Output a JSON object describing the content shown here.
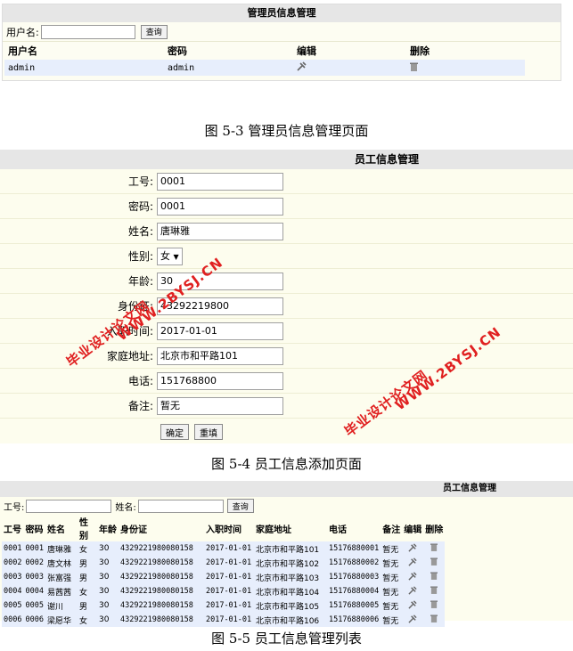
{
  "admin": {
    "title": "管理员信息管理",
    "search_label": "用户名:",
    "search_value": "",
    "search_button": "查询",
    "columns": [
      "用户名",
      "密码",
      "编辑",
      "删除"
    ],
    "rows": [
      {
        "username": "admin",
        "password": "admin"
      }
    ]
  },
  "caption1": "图 5-3 管理员信息管理页面",
  "employee_form": {
    "title": "员工信息管理",
    "fields": [
      {
        "label": "工号:",
        "value": "0001"
      },
      {
        "label": "密码:",
        "value": "0001"
      },
      {
        "label": "姓名:",
        "value": "唐琳雅"
      },
      {
        "label": "性别:",
        "value": "女"
      },
      {
        "label": "年龄:",
        "value": "30"
      },
      {
        "label": "身份证:",
        "value": "43292219800"
      },
      {
        "label": "入职时间:",
        "value": "2017-01-01"
      },
      {
        "label": "家庭地址:",
        "value": "北京市和平路101"
      },
      {
        "label": "电话:",
        "value": "151768800"
      },
      {
        "label": "备注:",
        "value": "暂无"
      }
    ],
    "confirm_button": "确定",
    "reset_button": "重填"
  },
  "caption2": "图 5-4 员工信息添加页面",
  "watermarks": {
    "line1": "毕业设计论文网",
    "line2": "WWW.2BYSJ.CN"
  },
  "employee_list": {
    "title": "员工信息管理",
    "search_id_label": "工号:",
    "search_name_label": "姓名:",
    "search_button": "查询",
    "columns": [
      "工号",
      "密码",
      "姓名",
      "性别",
      "年龄",
      "身份证",
      "入职时间",
      "家庭地址",
      "电话",
      "备注",
      "编辑",
      "删除"
    ],
    "rows": [
      [
        "0001",
        "0001",
        "唐琳雅",
        "女",
        "30",
        "432922198008015​8",
        "2017-01-01",
        "北京市和平路101",
        "15176880001",
        "暂无"
      ],
      [
        "0002",
        "0002",
        "唐文林",
        "男",
        "30",
        "4329221980080158",
        "2017-01-01",
        "北京市和平路102",
        "15176880002",
        "暂无"
      ],
      [
        "0003",
        "0003",
        "张富强",
        "男",
        "30",
        "4329221980080158",
        "2017-01-01",
        "北京市和平路103",
        "15176880003",
        "暂无"
      ],
      [
        "0004",
        "0004",
        "易茜茜",
        "女",
        "30",
        "4329221980080158",
        "2017-01-01",
        "北京市和平路104",
        "15176880004",
        "暂无"
      ],
      [
        "0005",
        "0005",
        "谢川",
        "男",
        "30",
        "4329221980080158",
        "2017-01-01",
        "北京市和平路105",
        "15176880005",
        "暂无"
      ],
      [
        "0006",
        "0006",
        "梁愿华",
        "女",
        "30",
        "4329221980080158",
        "2017-01-01",
        "北京市和平路106",
        "15176880006",
        "暂无"
      ]
    ]
  },
  "caption3": "图 5-5 员工信息管理列表",
  "icons": {
    "edit": "edit-tools-icon",
    "delete": "trash-icon"
  }
}
